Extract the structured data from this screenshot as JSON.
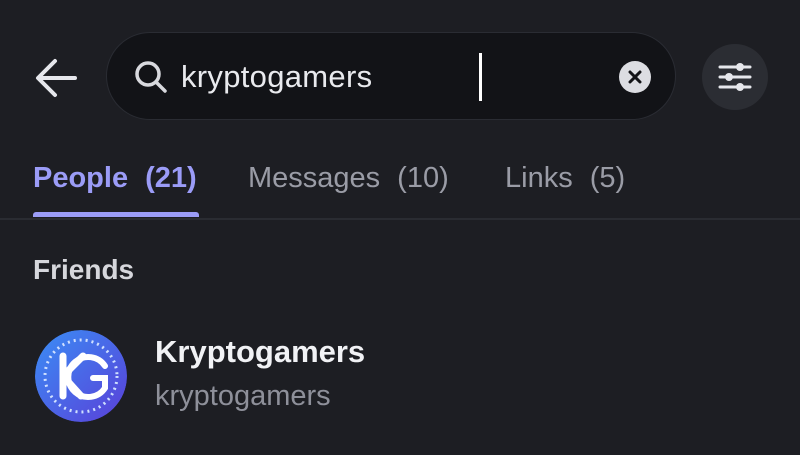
{
  "search": {
    "value": "kryptogamers"
  },
  "icons": {
    "back": "arrow-left-icon",
    "search": "magnifier-icon",
    "clear": "close-circle-icon",
    "filter": "sliders-icon"
  },
  "tabs": [
    {
      "label": "People",
      "count": "(21)",
      "active": true
    },
    {
      "label": "Messages",
      "count": "(10)",
      "active": false
    },
    {
      "label": "Links",
      "count": "(5)",
      "active": false
    }
  ],
  "results": {
    "section_title": "Friends",
    "items": [
      {
        "display_name": "Kryptogamers",
        "username": "kryptogamers"
      }
    ]
  },
  "colors": {
    "background": "#1d1e23",
    "search_background": "#121317",
    "accent": "#9b9cf7",
    "muted_text": "#9a9ca6"
  }
}
